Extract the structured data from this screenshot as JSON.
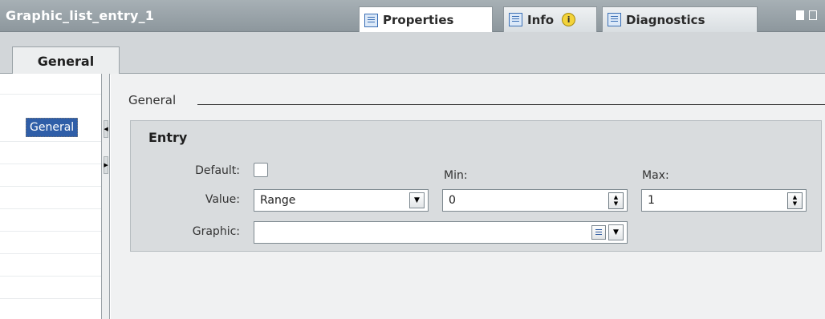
{
  "window": {
    "title": "Graphic_list_entry_1"
  },
  "inspector_tabs": [
    {
      "label": "Properties",
      "icon": "properties-icon",
      "active": true
    },
    {
      "label": "Info",
      "icon": "info-icon",
      "badge": "i"
    },
    {
      "label": "Diagnostics",
      "icon": "diagnostics-icon"
    }
  ],
  "section_tabs": [
    {
      "label": "General"
    }
  ],
  "nav": {
    "items": [
      {
        "label": "General",
        "selected": true
      }
    ]
  },
  "group": {
    "title": "General"
  },
  "entry": {
    "title": "Entry",
    "default_label": "Default:",
    "default_checked": false,
    "value_label": "Value:",
    "value_selected": "Range",
    "min_label": "Min:",
    "min_value": "0",
    "max_label": "Max:",
    "max_value": "1",
    "graphic_label": "Graphic:",
    "graphic_value": ""
  },
  "colors": {
    "titlebar": "#9aa3a8",
    "selection": "#2f5ea8",
    "panel": "#d9dcde",
    "info_badge": "#f3d33a"
  }
}
